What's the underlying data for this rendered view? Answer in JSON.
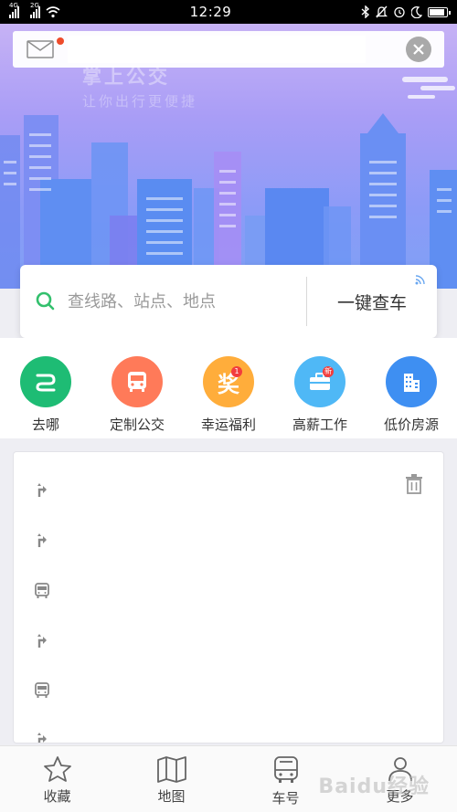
{
  "status_bar": {
    "sim1": "4G",
    "sim2": "2G",
    "time": "12:29",
    "icons": [
      "bluetooth-icon",
      "mute-icon",
      "alarm-icon",
      "moon-icon",
      "battery-icon"
    ]
  },
  "hero": {
    "title": "掌上公交",
    "subtitle": "让你出行更便捷",
    "gradient": [
      "#c6b2f5",
      "#7ea0f6"
    ]
  },
  "top_bar": {
    "message_text": "",
    "has_unread": true
  },
  "search": {
    "placeholder": "查线路、站点、地点",
    "quick_button": "一键查车"
  },
  "quick_icons": [
    {
      "label": "去哪",
      "color": "#1ebc74",
      "icon": "route-icon",
      "badge": ""
    },
    {
      "label": "定制公交",
      "color": "#ff7a59",
      "icon": "bus-icon",
      "badge": ""
    },
    {
      "label": "幸运福利",
      "color": "#ffad3b",
      "icon": "prize-icon",
      "badge": "1"
    },
    {
      "label": "高薪工作",
      "color": "#4fb8f6",
      "icon": "briefcase-icon",
      "badge": "新"
    },
    {
      "label": "低价房源",
      "color": "#3e8ff2",
      "icon": "building-icon",
      "badge": ""
    }
  ],
  "history": {
    "items": [
      {
        "type": "route-icon",
        "text": ""
      },
      {
        "type": "route-icon",
        "text": ""
      },
      {
        "type": "bus-icon",
        "text": ""
      },
      {
        "type": "route-icon",
        "text": ""
      },
      {
        "type": "bus-icon",
        "text": ""
      },
      {
        "type": "route-icon",
        "text": ""
      }
    ]
  },
  "bottom_nav": [
    {
      "label": "收藏",
      "icon": "star-icon"
    },
    {
      "label": "地图",
      "icon": "map-icon"
    },
    {
      "label": "车号",
      "icon": "bus-front-icon"
    },
    {
      "label": "更多",
      "icon": "user-icon"
    }
  ],
  "watermark": "Baidu经验"
}
